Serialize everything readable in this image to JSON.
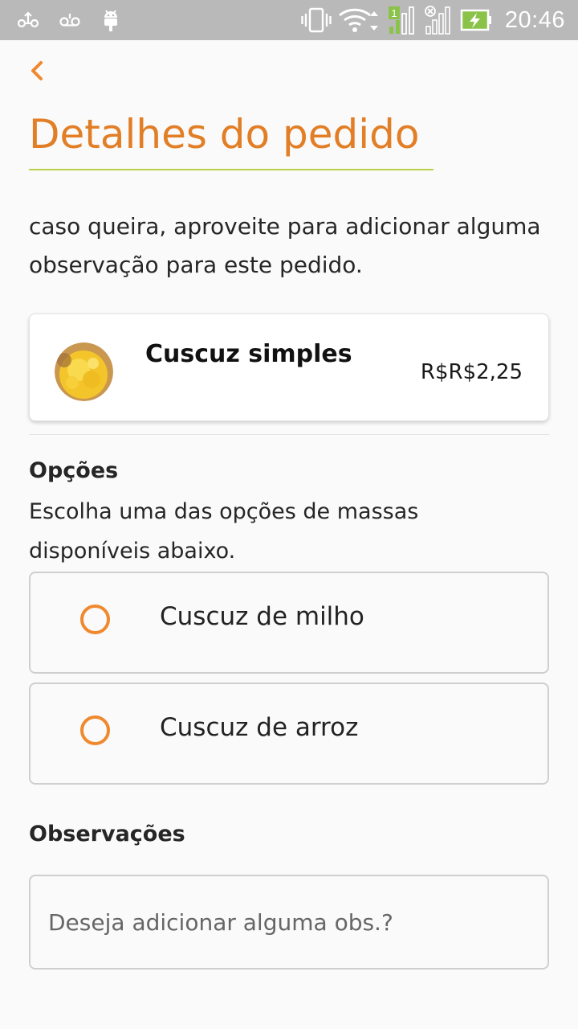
{
  "status_bar": {
    "time": "20:46",
    "sim_badge": "1",
    "icons": [
      "usb-icon",
      "voicemail-icon",
      "android-debug-icon",
      "vibrate-icon",
      "wifi-icon",
      "signal-icon",
      "battery-charging-icon"
    ],
    "colors": {
      "background": "#b9b9b9",
      "icon": "#ffffff",
      "accent": "#8bc34a"
    }
  },
  "header": {
    "back_icon": "chevron-left-icon",
    "title": "Detalhes do pedido",
    "title_color": "#e17e26",
    "underline_color": "#bcd14a"
  },
  "intro_text": "caso queira, aproveite para adicionar alguma observação para este pedido.",
  "product": {
    "name": "Cuscuz simples",
    "price": "R$R$2,25",
    "image": "cuscuz-thumbnail"
  },
  "options": {
    "title": "Opções",
    "description": "Escolha uma das opções de massas disponíveis abaixo.",
    "items": [
      {
        "label": "Cuscuz de milho",
        "selected": false
      },
      {
        "label": "Cuscuz de arroz",
        "selected": false
      }
    ],
    "radio_color": "#f0892e"
  },
  "notes": {
    "title": "Observações",
    "value": "",
    "placeholder": "Deseja adicionar alguma obs.?"
  }
}
